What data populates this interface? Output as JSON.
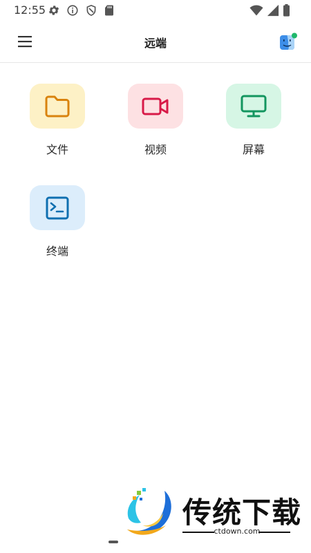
{
  "status_bar": {
    "time": "12:55",
    "left_icons": [
      "gear-icon",
      "info-icon",
      "shield-icon",
      "sd-card-icon"
    ],
    "right_icons": [
      "wifi-icon",
      "signal-icon",
      "battery-icon"
    ]
  },
  "app_bar": {
    "title": "远端",
    "menu_icon": "hamburger-menu-icon",
    "avatar_icon": "finder-face-icon",
    "avatar_status_color": "#1fb86b"
  },
  "tiles": [
    {
      "label": "文件",
      "icon": "folder-icon",
      "bg": "#fdf1c6",
      "color": "#d9830e"
    },
    {
      "label": "视频",
      "icon": "video-camera-icon",
      "bg": "#fde1e3",
      "color": "#d81a48"
    },
    {
      "label": "屏幕",
      "icon": "monitor-icon",
      "bg": "#d6f6e5",
      "color": "#13955f"
    },
    {
      "label": "终端",
      "icon": "terminal-icon",
      "bg": "#dcedfb",
      "color": "#0f6fb0"
    }
  ],
  "watermark": {
    "title": "传统下载",
    "subtitle": "ctdown.com"
  }
}
